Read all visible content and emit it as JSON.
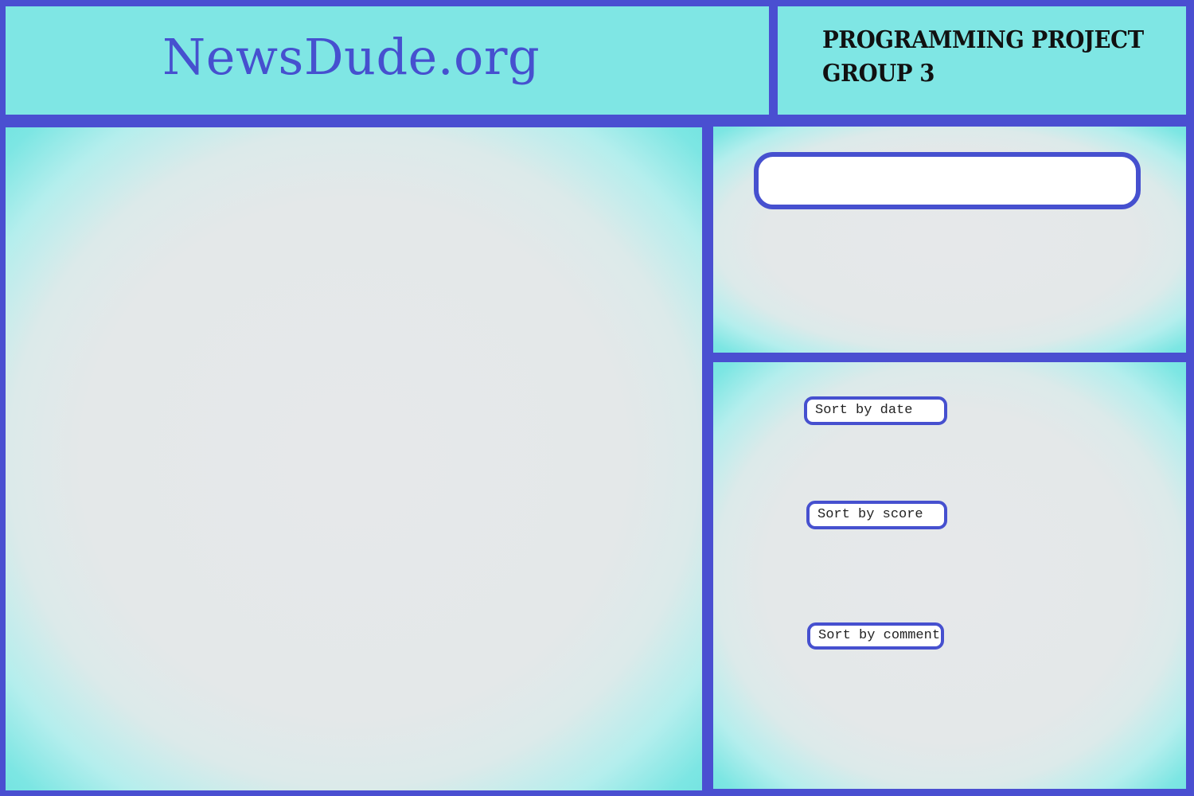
{
  "header": {
    "site_title": "NewsDude.org",
    "project_line1": "PROGRAMMING PROJECT",
    "project_line2": "GROUP 3"
  },
  "search": {
    "value": "",
    "placeholder": ""
  },
  "sort": {
    "date_label": "Sort by date",
    "score_label": "Sort by score",
    "comments_label": "Sort by comments"
  },
  "colors": {
    "border": "#4a4fd1",
    "panel_teal": "#7fe6e4",
    "panel_center": "#e6e8ea",
    "title_text": "#4650cf",
    "project_text": "#111111"
  }
}
